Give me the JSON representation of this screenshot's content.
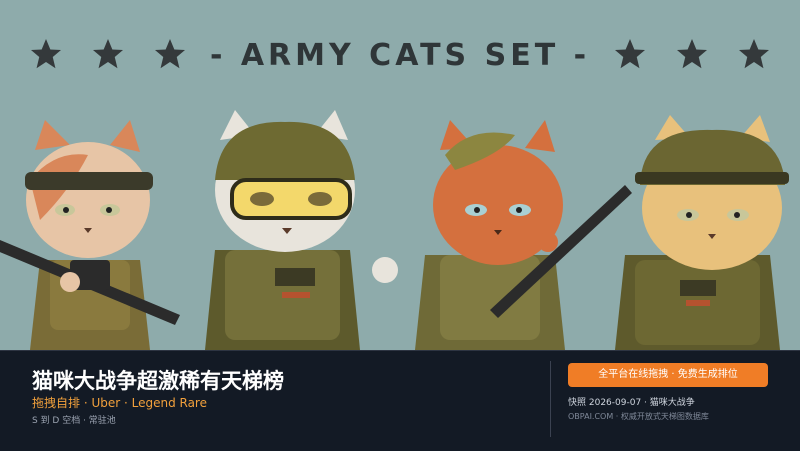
{
  "poster": {
    "title": "- ARMY CATS SET -",
    "colors": {
      "background": "#8eabab",
      "star": "#34393b",
      "title": "#2f3638"
    },
    "cats": [
      {
        "name": "cat-calico-rifle",
        "fur": "#d9875a",
        "helmet": "headband"
      },
      {
        "name": "cat-white-goggles",
        "fur": "#e8e4dc",
        "helmet": "helmet"
      },
      {
        "name": "cat-orange-beret",
        "fur": "#d4703e",
        "helmet": "beret"
      },
      {
        "name": "cat-cream-helmet",
        "fur": "#e8c17c",
        "helmet": "helmet"
      }
    ],
    "icons": [
      "star-icon"
    ]
  },
  "info": {
    "title": "猫咪大战争超激稀有天梯榜",
    "subtitle": "拖拽自排 · Uber · Legend Rare",
    "meta": "S 到 D 空档 · 常驻池",
    "cta": "全平台在线拖拽 · 免费生成排位",
    "snapshot": "快照 2026-09-07 · 猫咪大战争",
    "source": "OBPAI.COM · 权威开放式天梯图数据库",
    "colors": {
      "bar": "#131a25",
      "accent": "#f07d26",
      "subtitle": "#f1a03c"
    }
  }
}
